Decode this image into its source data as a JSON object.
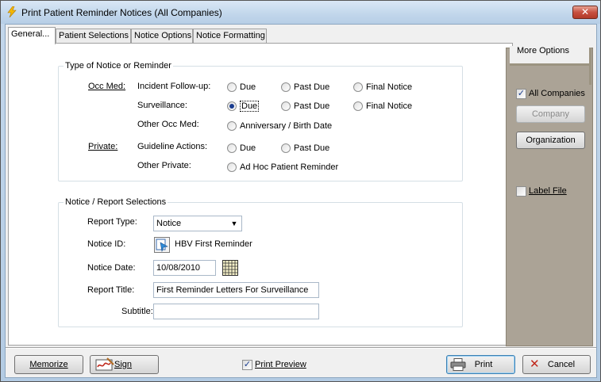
{
  "window": {
    "title": "Print Patient Reminder Notices (All Companies)",
    "close_label": "✕"
  },
  "tabs": [
    {
      "label": "General..."
    },
    {
      "label": "Patient Selections"
    },
    {
      "label": "Notice Options"
    },
    {
      "label": "Notice Formatting"
    }
  ],
  "notice_type": {
    "group_title": "Type of Notice or Reminder",
    "occ_med_label": "Occ Med:",
    "incident_label": "Incident Follow-up:",
    "surveillance_label": "Surveillance:",
    "other_occ_label": "Other Occ Med:",
    "private_label": "Private:",
    "guideline_label": "Guideline Actions:",
    "other_private_label": "Other Private:",
    "due": "Due",
    "past_due": "Past Due",
    "final_notice": "Final Notice",
    "anniversary": "Anniversary / Birth Date",
    "ad_hoc": "Ad Hoc Patient Reminder",
    "selected": "surveillance-due"
  },
  "report": {
    "group_title": "Notice / Report Selections",
    "report_type_label": "Report Type:",
    "report_type_value": "Notice",
    "notice_id_label": "Notice ID:",
    "notice_id_value": "HBV First Reminder",
    "notice_date_label": "Notice Date:",
    "notice_date_value": "10/08/2010",
    "report_title_label": "Report Title:",
    "report_title_value": "First Reminder Letters For Surveillance",
    "subtitle_label": "Subtitle:",
    "subtitle_value": ""
  },
  "more_options": {
    "title": "More Options",
    "all_companies_label": "All Companies",
    "all_companies_checked": true,
    "company_label": "Company",
    "organization_label": "Organization",
    "label_file_label": "Label File",
    "label_file_checked": false
  },
  "footer": {
    "memorize_label": "Memorize",
    "sign_label": "Sign",
    "print_preview_label": "Print Preview",
    "print_preview_checked": true,
    "print_label": "Print",
    "cancel_label": "Cancel"
  },
  "colors": {
    "accent": "#1a3d8f",
    "panel": "#aba396",
    "cancel_x": "#c0281c"
  }
}
